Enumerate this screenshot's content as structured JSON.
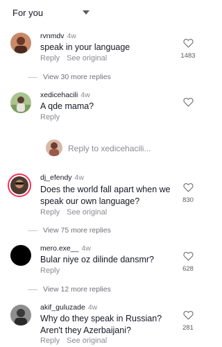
{
  "header": {
    "sort_label": "For you"
  },
  "comments": [
    {
      "username": "rvnmdv",
      "time": "4w",
      "text": "speak in your language",
      "reply": "Reply",
      "see_original": "See original",
      "likes": "1483",
      "more_replies": "View 30 more replies"
    },
    {
      "username": "xedicehacili",
      "time": "4w",
      "text": "A qde mama?",
      "reply": "Reply",
      "likes": ""
    },
    {
      "username": "dj_efendy",
      "time": "4w",
      "text": "Does the world fall apart when we speak our own language?",
      "reply": "Reply",
      "see_original": "See original",
      "likes": "830",
      "more_replies": "View 75 more replies"
    },
    {
      "username": "mero.exe__",
      "time": "4w",
      "text": "Bular niye oz dilinde dansmr?",
      "reply": "Reply",
      "likes": "628",
      "more_replies": "View 12 more replies"
    },
    {
      "username": "akif_guluzade",
      "time": "4w",
      "text": "Why do they speak in Russian? Aren't they Azerbaijani?",
      "reply": "Reply",
      "see_original": "See original",
      "likes": "281"
    }
  ],
  "reply_to": {
    "text": "Reply to xedicehacili..."
  },
  "icons": {
    "sort": "chevron-down-icon",
    "like": "heart-outline-icon"
  },
  "colors": {
    "text": "#161823",
    "muted": "#8a8b91",
    "story_ring": "#fe2c55"
  }
}
